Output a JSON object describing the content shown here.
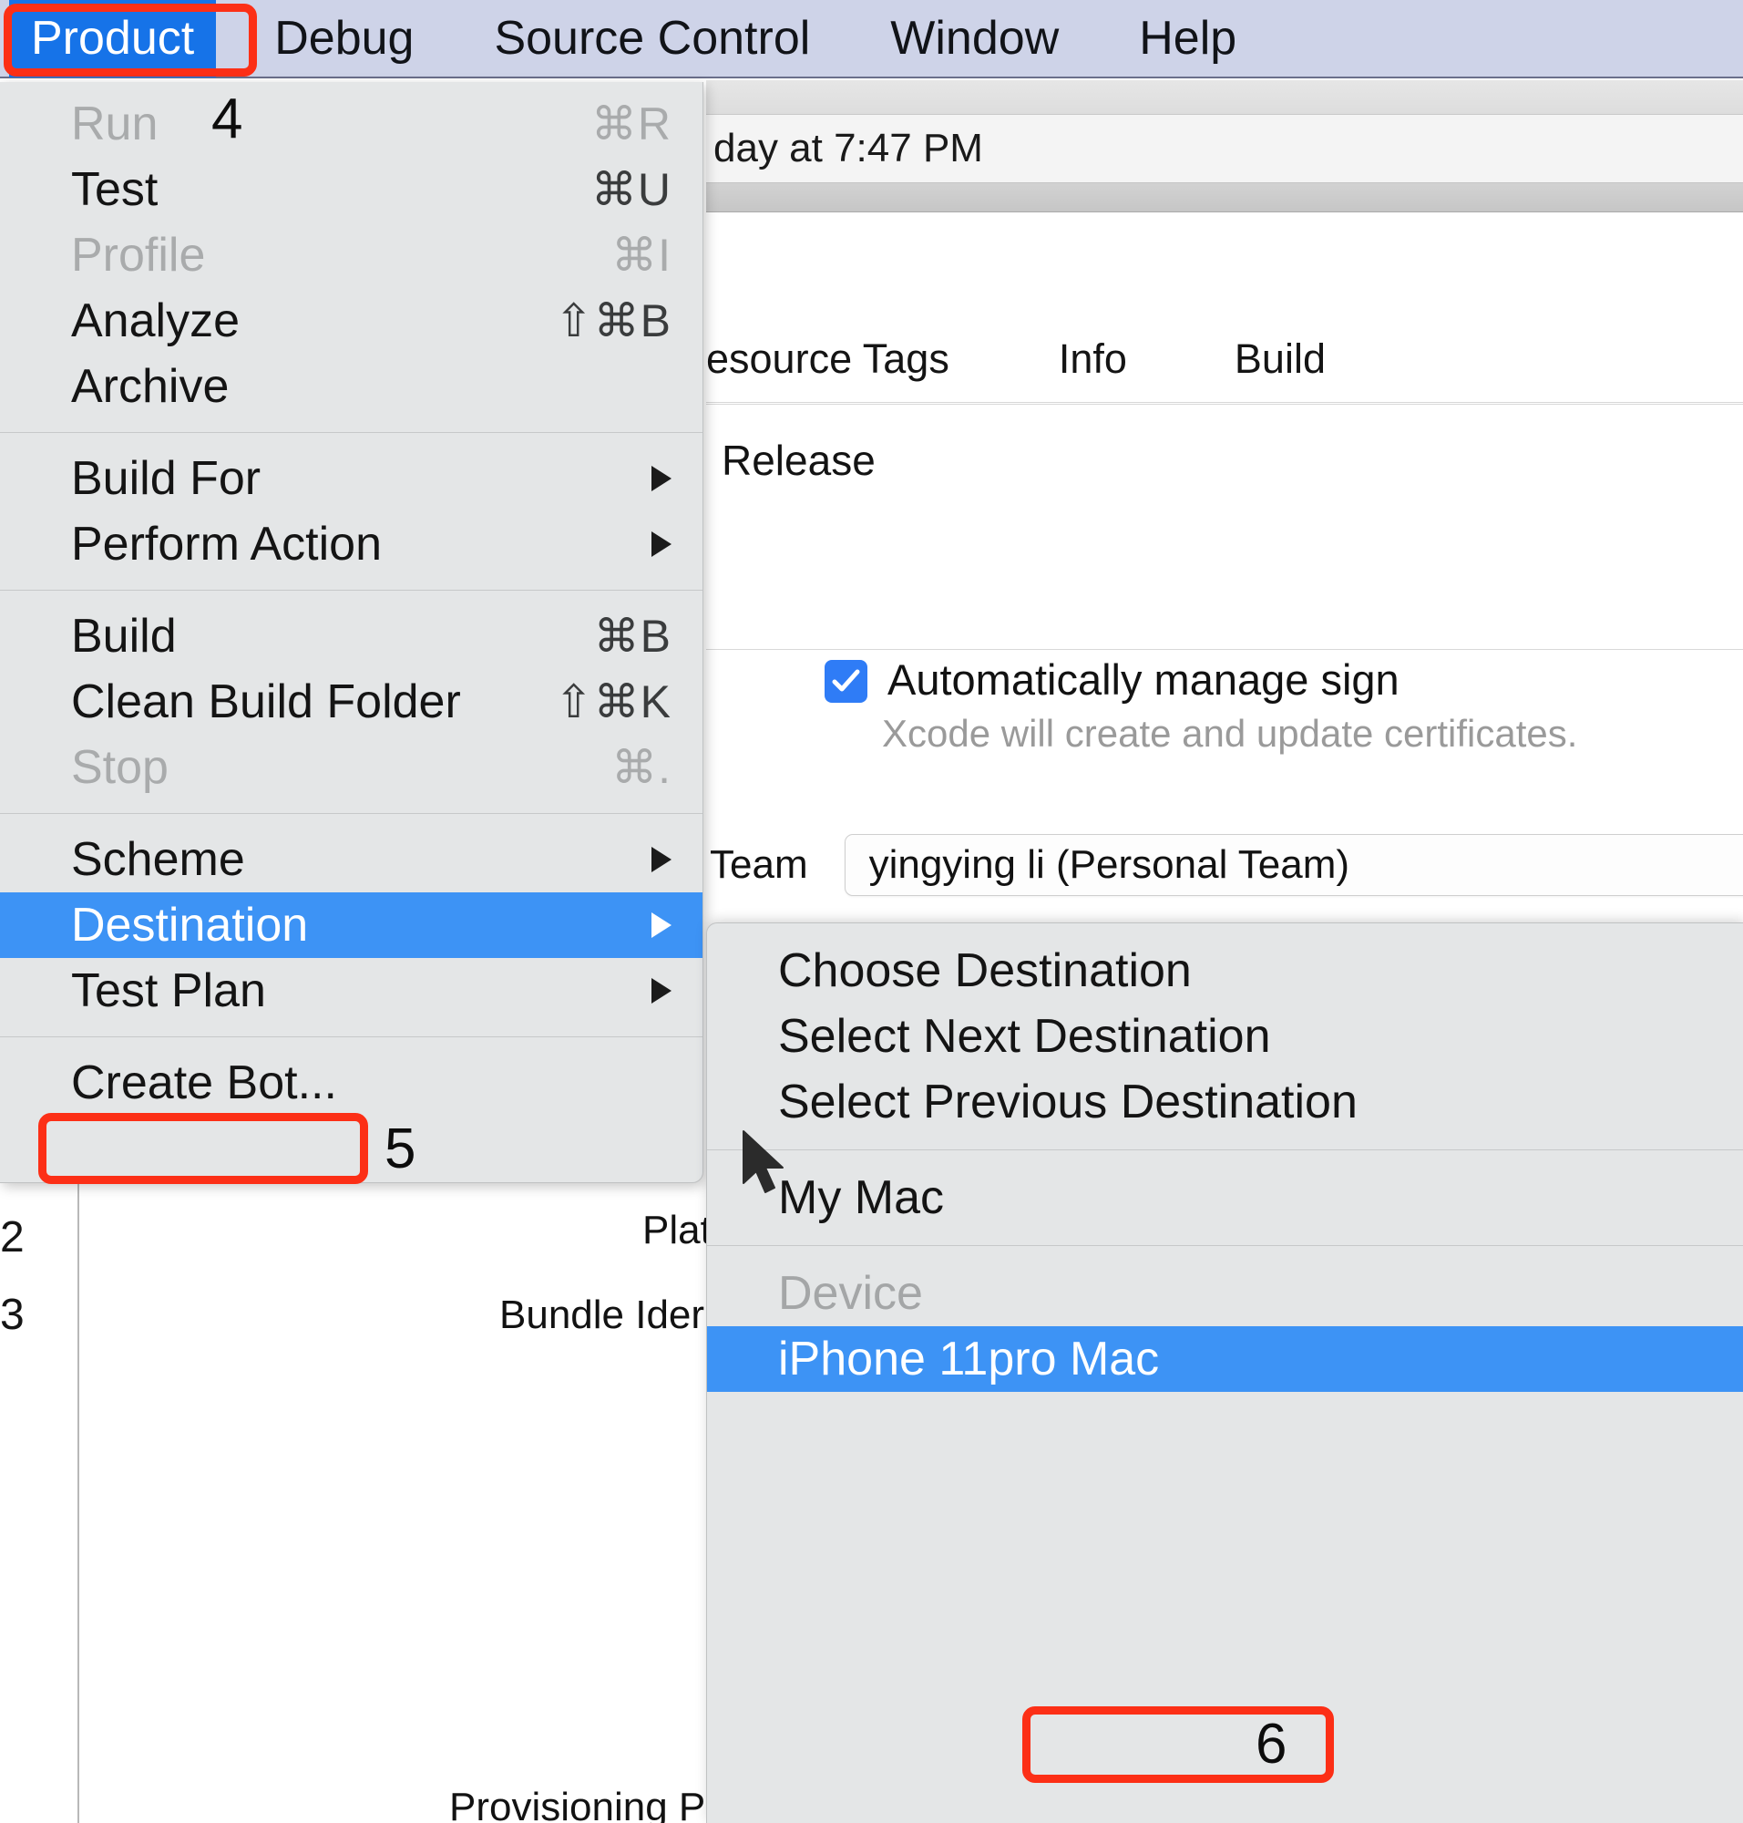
{
  "menubar": {
    "items": [
      {
        "label": "Product",
        "active": true
      },
      {
        "label": "Debug",
        "active": false
      },
      {
        "label": "Source Control",
        "active": false
      },
      {
        "label": "Window",
        "active": false
      },
      {
        "label": "Help",
        "active": false
      }
    ]
  },
  "product_menu": {
    "items": [
      {
        "label": "Run",
        "shortcut": "⌘R",
        "disabled": true,
        "arrow": false
      },
      {
        "label": "Test",
        "shortcut": "⌘U",
        "disabled": false,
        "arrow": false
      },
      {
        "label": "Profile",
        "shortcut": "⌘I",
        "disabled": true,
        "arrow": false
      },
      {
        "label": "Analyze",
        "shortcut": "⇧⌘B",
        "disabled": false,
        "arrow": false
      },
      {
        "label": "Archive",
        "shortcut": "",
        "disabled": false,
        "arrow": false
      },
      {
        "label": "Build For",
        "shortcut": "",
        "disabled": false,
        "arrow": true
      },
      {
        "label": "Perform Action",
        "shortcut": "",
        "disabled": false,
        "arrow": true
      },
      {
        "label": "Build",
        "shortcut": "⌘B",
        "disabled": false,
        "arrow": false
      },
      {
        "label": "Clean Build Folder",
        "shortcut": "⇧⌘K",
        "disabled": false,
        "arrow": false
      },
      {
        "label": "Stop",
        "shortcut": "⌘.",
        "disabled": true,
        "arrow": false
      },
      {
        "label": "Scheme",
        "shortcut": "",
        "disabled": false,
        "arrow": true
      },
      {
        "label": "Destination",
        "shortcut": "",
        "disabled": false,
        "arrow": true,
        "selected": true
      },
      {
        "label": "Test Plan",
        "shortcut": "",
        "disabled": false,
        "arrow": true
      },
      {
        "label": "Create Bot...",
        "shortcut": "",
        "disabled": false,
        "arrow": false
      }
    ]
  },
  "destination_submenu": {
    "items": [
      {
        "label": "Choose Destination"
      },
      {
        "label": "Select Next Destination"
      },
      {
        "label": "Select Previous Destination"
      },
      {
        "label": "My Mac"
      },
      {
        "label": "Device",
        "header": true
      },
      {
        "label": "iPhone 11pro Mac",
        "selected": true
      }
    ]
  },
  "background": {
    "date_text": "day at 7:47 PM",
    "tabs": [
      "esource Tags",
      "Info",
      "Build"
    ],
    "configuration": "Release",
    "signing": {
      "checkbox_label": "Automatically manage sign",
      "note": "Xcode will create and update certificates.",
      "checked": true
    },
    "team": {
      "label": "Team",
      "value": "yingying li (Personal Team)"
    },
    "line_numbers": [
      "2",
      "3"
    ],
    "field_labels": {
      "platform": "Plat",
      "bundle_identifier": "Bundle Ider",
      "provisioning": "Provisioning P"
    }
  },
  "annotations": {
    "step4": "4",
    "step5": "5",
    "step6": "6",
    "highlight_color": "#fc2f16"
  }
}
